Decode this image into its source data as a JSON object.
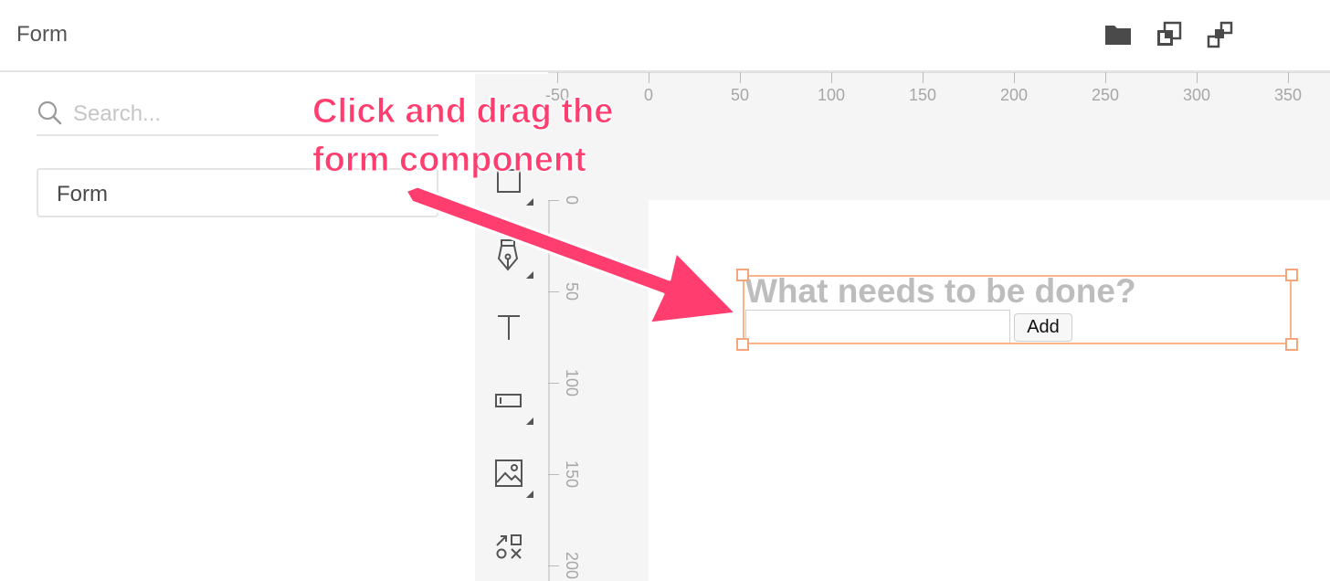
{
  "window": {
    "title": "Form"
  },
  "header_icons": [
    "folder-icon",
    "duplicate-icon",
    "layers-icon"
  ],
  "search": {
    "placeholder": "Search...",
    "value": ""
  },
  "components": [
    {
      "label": "Form"
    }
  ],
  "toolbar": {
    "tools": [
      "rectangle-tool",
      "pen-tool",
      "text-tool",
      "input-tool",
      "image-tool",
      "symbols-tool"
    ]
  },
  "rulers": {
    "horizontal": [
      "-50",
      "0",
      "50",
      "100",
      "150",
      "200",
      "250",
      "300",
      "350"
    ],
    "vertical": [
      "0",
      "50",
      "100",
      "150",
      "200"
    ]
  },
  "form": {
    "heading": "What needs to be done?",
    "input_value": "",
    "button_label": "Add"
  },
  "annotation": {
    "line1": "Click and drag the",
    "line2": "form component",
    "color": "#ff3d6e"
  },
  "colors": {
    "selection": "#f9b48b",
    "panel_bg": "#f5f5f5",
    "accent": "#ff3d6e"
  }
}
